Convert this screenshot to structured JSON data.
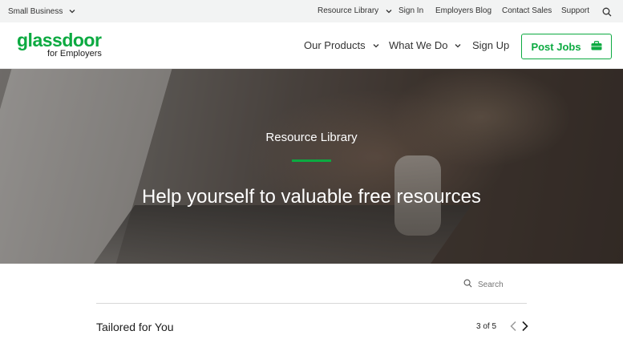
{
  "utility_bar": {
    "segment_label": "Small Business",
    "links": [
      "Resource Library",
      "Sign In",
      "Employers Blog",
      "Contact Sales",
      "Support"
    ]
  },
  "nav": {
    "logo_word": "glassdoor",
    "logo_sub": "for Employers",
    "items": [
      "Our Products",
      "What We Do",
      "Sign Up"
    ],
    "post_jobs": "Post Jobs"
  },
  "hero": {
    "kicker": "Resource Library",
    "title": "Help yourself to valuable free resources"
  },
  "search": {
    "placeholder": "Search"
  },
  "section": {
    "title": "Tailored for You",
    "pager": "3 of 5"
  },
  "colors": {
    "brand_green": "#0caa41",
    "utility_bg": "#f2f3f3"
  },
  "icons": [
    "chevron-down-icon",
    "search-icon",
    "briefcase-icon",
    "chevron-left-icon",
    "chevron-right-icon"
  ]
}
